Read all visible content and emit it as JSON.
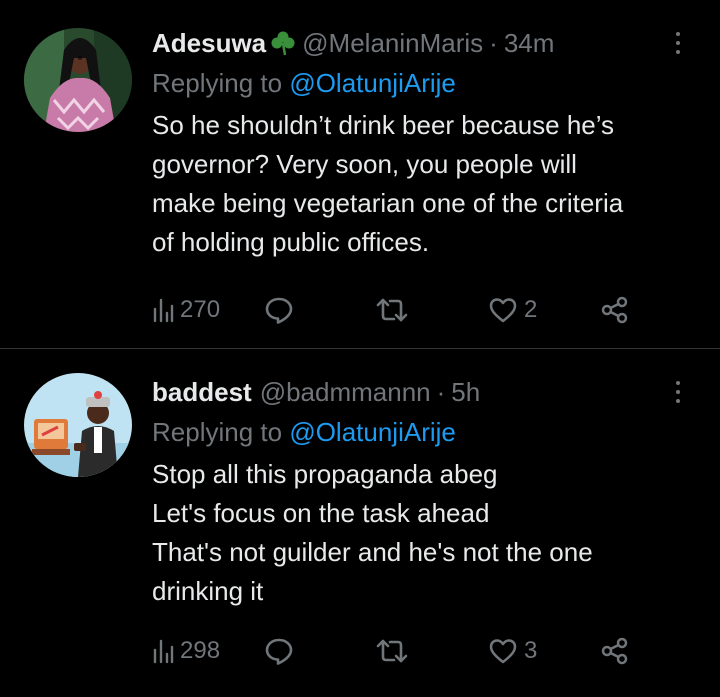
{
  "tweets": [
    {
      "name": "Adesuwa",
      "badge_icon": "shamrock-icon",
      "handle": "@MelaninMaris",
      "separator": "·",
      "time": "34m",
      "replying_prefix": "Replying to ",
      "replying_to": "@OlatunjiArije",
      "lines": [
        "So he shouldn’t drink beer because he’s",
        "governor? Very soon, you people will",
        "make being vegetarian one of the criteria",
        "of holding public offices."
      ],
      "views": "270",
      "replies": "",
      "retweets": "",
      "likes": "2"
    },
    {
      "name": "baddest",
      "handle": "@badmmannn",
      "separator": "·",
      "time": "5h",
      "replying_prefix": "Replying to ",
      "replying_to": "@OlatunjiArije",
      "lines": [
        "Stop all this propaganda abeg",
        "Let's focus on the task ahead",
        "That's not guilder and he's not the one",
        "drinking it"
      ],
      "views": "298",
      "replies": "",
      "retweets": "",
      "likes": "3"
    }
  ],
  "colors": {
    "background": "#000000",
    "text": "#e7e9ea",
    "secondary": "#71767b",
    "link": "#1d9bf0",
    "divider": "#2f3336",
    "shamrock": "#3a8f3a"
  }
}
